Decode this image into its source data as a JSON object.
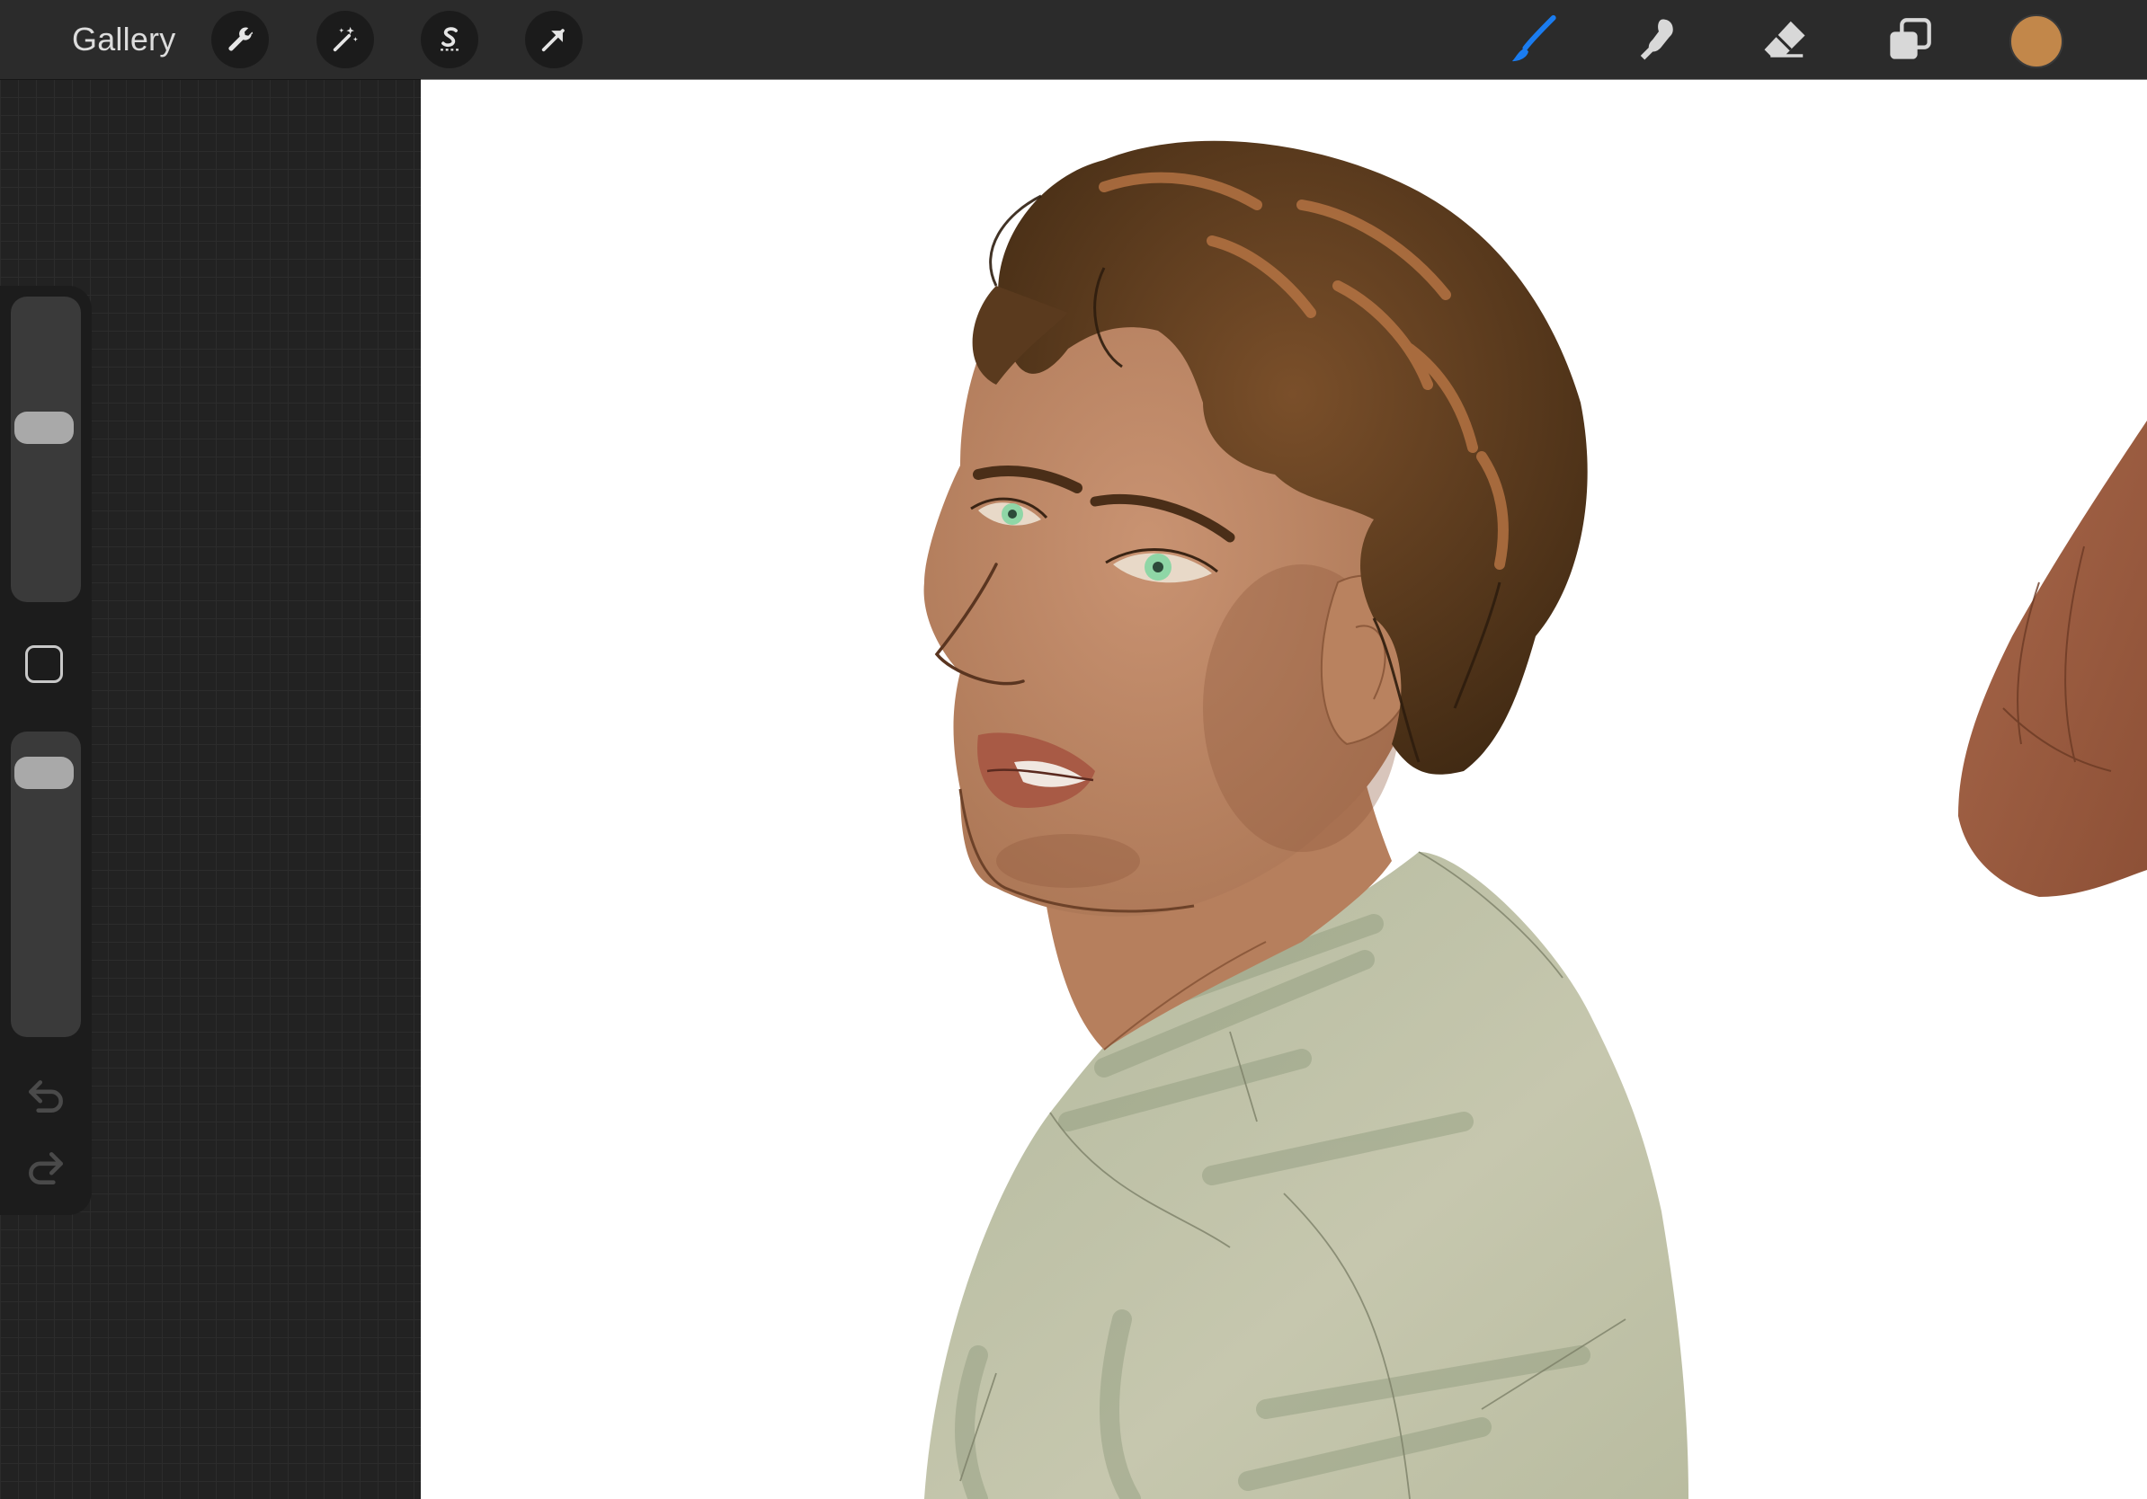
{
  "toolbar": {
    "gallery_label": "Gallery",
    "left_tools": [
      {
        "name": "actions",
        "icon": "wrench-icon"
      },
      {
        "name": "adjustments",
        "icon": "magic-wand-icon"
      },
      {
        "name": "selection",
        "icon": "selection-s-icon"
      },
      {
        "name": "transform",
        "icon": "arrow-cursor-icon"
      }
    ],
    "right_tools": [
      {
        "name": "brush",
        "icon": "brush-icon",
        "active": true
      },
      {
        "name": "smudge",
        "icon": "smudge-icon",
        "active": false
      },
      {
        "name": "eraser",
        "icon": "eraser-icon",
        "active": false
      },
      {
        "name": "layers",
        "icon": "layers-icon",
        "active": false
      }
    ],
    "current_color": "#c2874a",
    "active_color": "#1a7cf0"
  },
  "sidebar": {
    "brush_size_level": 0.58,
    "opacity_level": 0.92,
    "modify_button_icon": "square-modify-icon",
    "undo_icon": "undo-icon",
    "redo_icon": "redo-icon"
  },
  "canvas": {
    "skin_color": "#c08866",
    "hair_color": "#5a3a1e",
    "shirt_color": "#c6c7ae",
    "eye_color": "#8fd6a6"
  }
}
